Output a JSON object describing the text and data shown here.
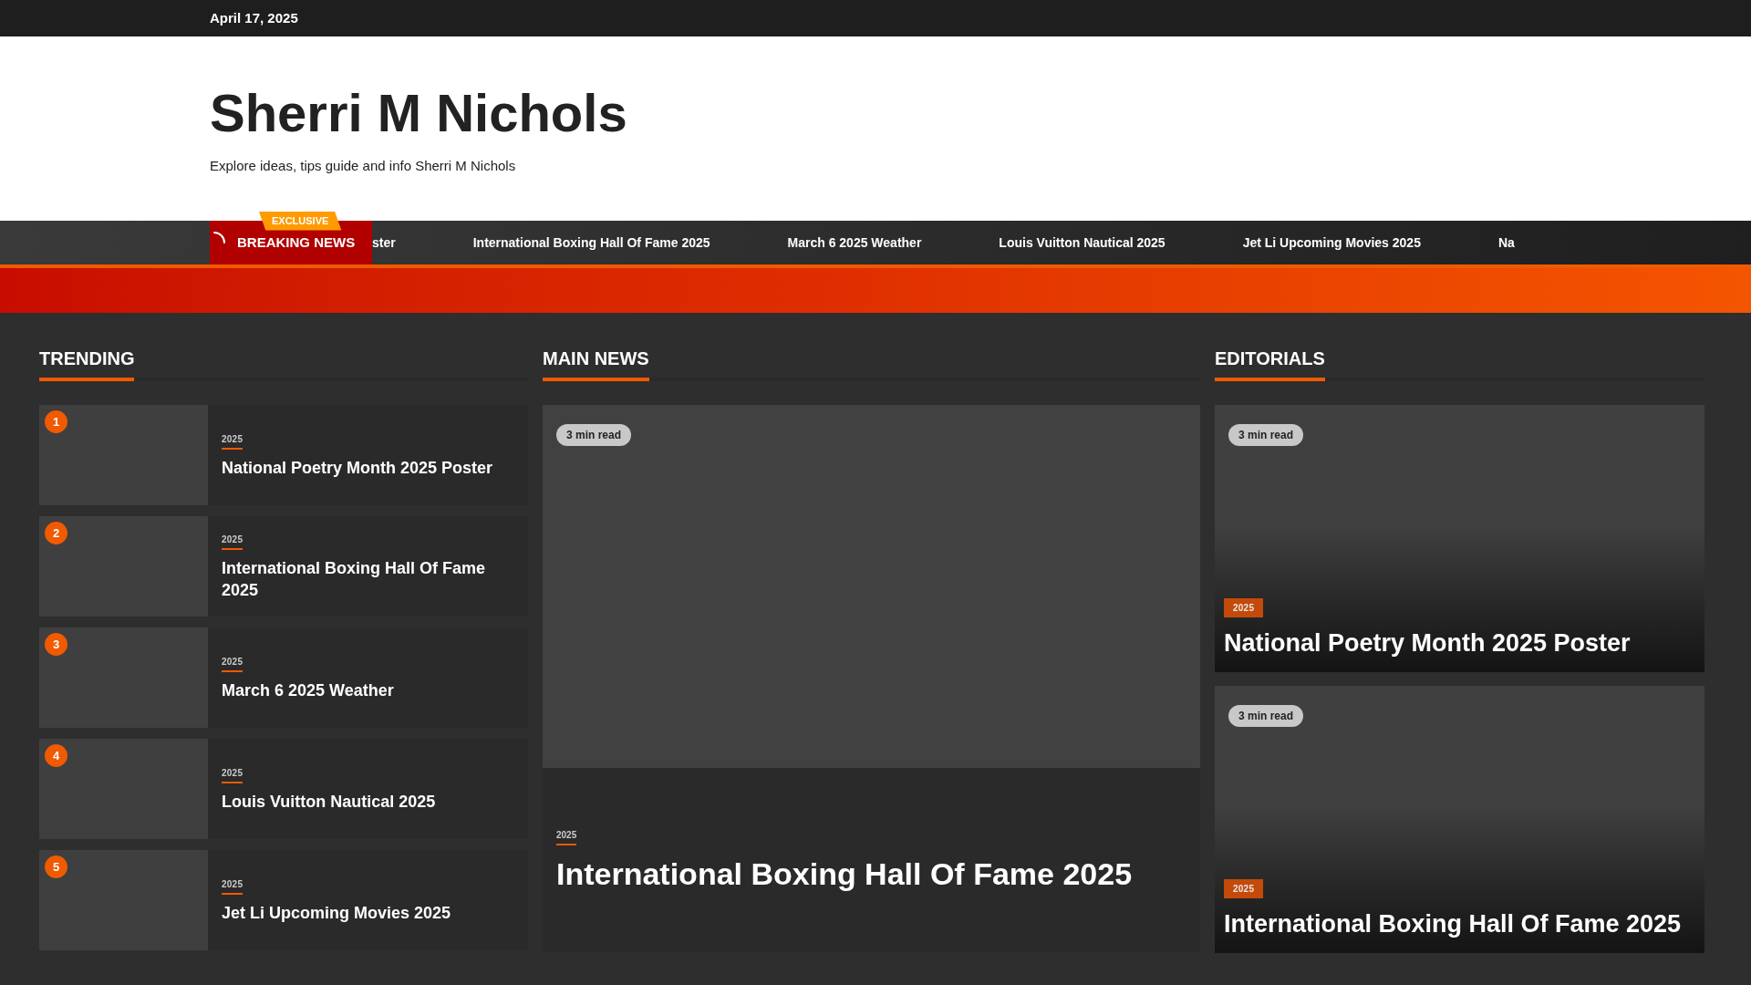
{
  "top_bar": {
    "date": "April 17, 2025"
  },
  "header": {
    "site_title": "Sherri M Nichols",
    "tagline": "Explore ideas, tips guide and info Sherri M Nichols"
  },
  "ticker": {
    "badge": "EXCLUSIVE",
    "label": "BREAKING NEWS",
    "items": [
      "ster",
      "International Boxing Hall Of Fame 2025",
      "March 6 2025 Weather",
      "Louis Vuitton Nautical 2025",
      "Jet Li Upcoming Movies 2025",
      "Na"
    ]
  },
  "trending": {
    "heading": "TRENDING",
    "items": [
      {
        "rank": "1",
        "category": "2025",
        "title": "National Poetry Month 2025 Poster"
      },
      {
        "rank": "2",
        "category": "2025",
        "title": "International Boxing Hall Of Fame 2025"
      },
      {
        "rank": "3",
        "category": "2025",
        "title": "March 6 2025 Weather"
      },
      {
        "rank": "4",
        "category": "2025",
        "title": "Louis Vuitton Nautical 2025"
      },
      {
        "rank": "5",
        "category": "2025",
        "title": "Jet Li Upcoming Movies 2025"
      }
    ]
  },
  "main_news": {
    "heading": "MAIN NEWS",
    "read_time": "3 min read",
    "category": "2025",
    "title": "International Boxing Hall Of Fame 2025"
  },
  "editorials": {
    "heading": "EDITORIALS",
    "items": [
      {
        "read_time": "3 min read",
        "category": "2025",
        "title": "National Poetry Month 2025 Poster"
      },
      {
        "read_time": "3 min read",
        "category": "2025",
        "title": "International Boxing Hall Of Fame 2025"
      }
    ]
  }
}
